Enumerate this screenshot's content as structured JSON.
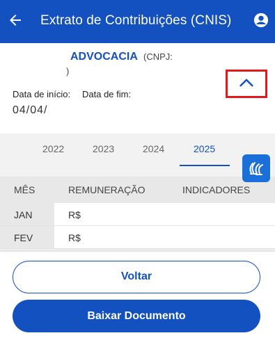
{
  "header": {
    "title": "Extrato de Contribuições (CNIS)",
    "back_icon": "arrow-left-icon",
    "account_icon": "account-circle-icon"
  },
  "card": {
    "company_name": "ADVOCACIA",
    "cnpj_label": "(CNPJ:",
    "cnpj_close": ")",
    "collapse_icon": "chevron-up-icon",
    "start_label": "Data de início:",
    "end_label": "Data de fim:",
    "start_value": "04/04/"
  },
  "tabs": [
    "2022",
    "2023",
    "2024",
    "2025"
  ],
  "active_tab": "2025",
  "table": {
    "headers": [
      "MÊS",
      "REMUNERAÇÃO",
      "INDICADORES"
    ],
    "rows": [
      {
        "month": "JAN",
        "remuneration": "R$"
      },
      {
        "month": "FEV",
        "remuneration": "R$"
      }
    ]
  },
  "accessibility_icon": "libras-hands-icon",
  "actions": {
    "back_label": "Voltar",
    "download_label": "Baixar Documento"
  },
  "colors": {
    "primary": "#1350c0",
    "highlight": "#e0191c",
    "accessibility": "#1a6fd8"
  }
}
